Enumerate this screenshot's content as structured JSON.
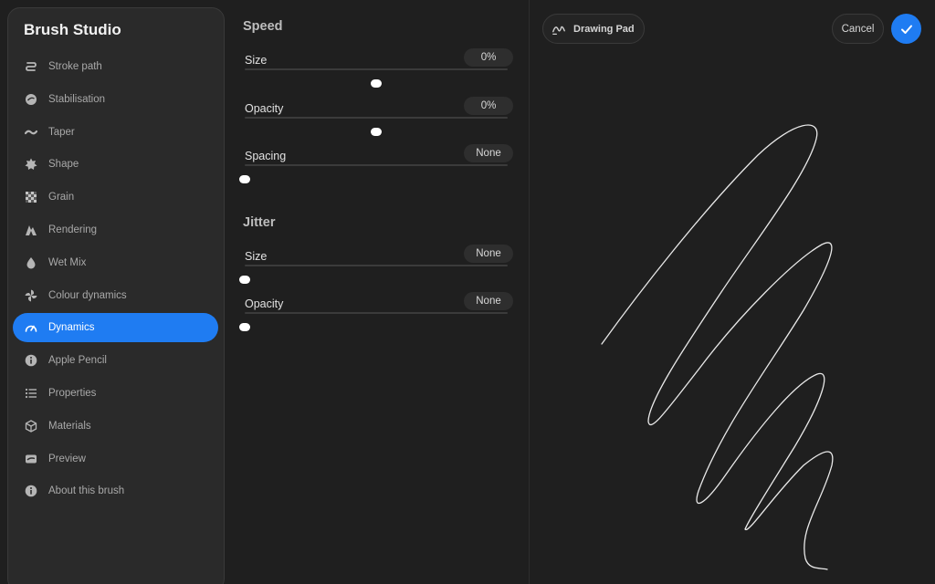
{
  "sidebar": {
    "title": "Brush Studio",
    "items": [
      {
        "label": "Stroke path",
        "icon": "stroke-path-icon",
        "active": false
      },
      {
        "label": "Stabilisation",
        "icon": "stabilisation-icon",
        "active": false
      },
      {
        "label": "Taper",
        "icon": "taper-icon",
        "active": false
      },
      {
        "label": "Shape",
        "icon": "shape-icon",
        "active": false
      },
      {
        "label": "Grain",
        "icon": "grain-icon",
        "active": false
      },
      {
        "label": "Rendering",
        "icon": "rendering-icon",
        "active": false
      },
      {
        "label": "Wet Mix",
        "icon": "wet-mix-icon",
        "active": false
      },
      {
        "label": "Colour dynamics",
        "icon": "colour-dynamics-icon",
        "active": false
      },
      {
        "label": "Dynamics",
        "icon": "dynamics-icon",
        "active": true
      },
      {
        "label": "Apple Pencil",
        "icon": "apple-pencil-info-icon",
        "active": false
      },
      {
        "label": "Properties",
        "icon": "properties-list-icon",
        "active": false
      },
      {
        "label": "Materials",
        "icon": "materials-cube-icon",
        "active": false
      },
      {
        "label": "Preview",
        "icon": "preview-icon",
        "active": false
      },
      {
        "label": "About this brush",
        "icon": "about-info-icon",
        "active": false
      }
    ]
  },
  "speed": {
    "title": "Speed",
    "rows": [
      {
        "label": "Size",
        "value": "0%",
        "position": 0.5
      },
      {
        "label": "Opacity",
        "value": "0%",
        "position": 0.5
      },
      {
        "label": "Spacing",
        "value": "None",
        "position": 0.0
      }
    ]
  },
  "jitter": {
    "title": "Jitter",
    "rows": [
      {
        "label": "Size",
        "value": "None",
        "position": 0.0
      },
      {
        "label": "Opacity",
        "value": "None",
        "position": 0.0
      }
    ]
  },
  "canvas": {
    "pad_label": "Drawing Pad",
    "cancel_label": "Cancel",
    "accent_color": "#1f7cf2"
  }
}
